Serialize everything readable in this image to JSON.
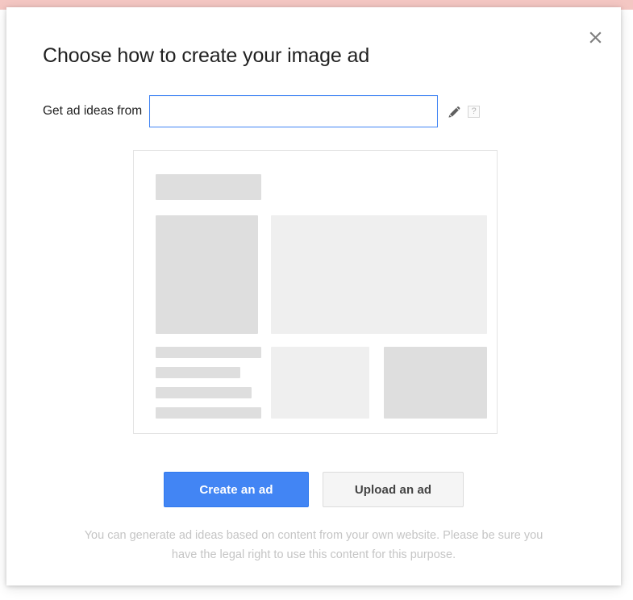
{
  "dialog": {
    "title": "Choose how to create your image ad",
    "close_label": "×",
    "close_icon": "close-icon"
  },
  "field": {
    "label": "Get ad ideas from",
    "value": "",
    "placeholder": "",
    "pencil_icon": "pencil-icon",
    "help_icon": "help-icon",
    "help_label": "?"
  },
  "preview": {
    "name": "ad-preview-skeleton",
    "blocks": [
      {
        "name": "skeleton-header-bar",
        "tone": "dark"
      },
      {
        "name": "skeleton-tall-image",
        "tone": "dark"
      },
      {
        "name": "skeleton-wide-image",
        "tone": "light"
      },
      {
        "name": "skeleton-text-line-1",
        "tone": "dark"
      },
      {
        "name": "skeleton-text-line-2",
        "tone": "dark"
      },
      {
        "name": "skeleton-text-line-3",
        "tone": "dark"
      },
      {
        "name": "skeleton-text-line-4",
        "tone": "dark"
      },
      {
        "name": "skeleton-box-left",
        "tone": "light"
      },
      {
        "name": "skeleton-box-right",
        "tone": "dark"
      }
    ]
  },
  "actions": {
    "create_label": "Create an ad",
    "upload_label": "Upload an ad"
  },
  "footer": {
    "note": "You can generate ad ideas based on content from your own website. Please be sure you have the legal right to use this content for this purpose."
  },
  "colors": {
    "primary_button": "#4285f4",
    "primary_button_border": "#3079ed",
    "secondary_button": "#f5f5f5",
    "input_focus_border": "#4285f4",
    "skeleton_dark": "#dedede",
    "skeleton_light": "#efefef",
    "footer_text": "#c5c5c5",
    "backdrop_strip": "#f4c7c3"
  }
}
